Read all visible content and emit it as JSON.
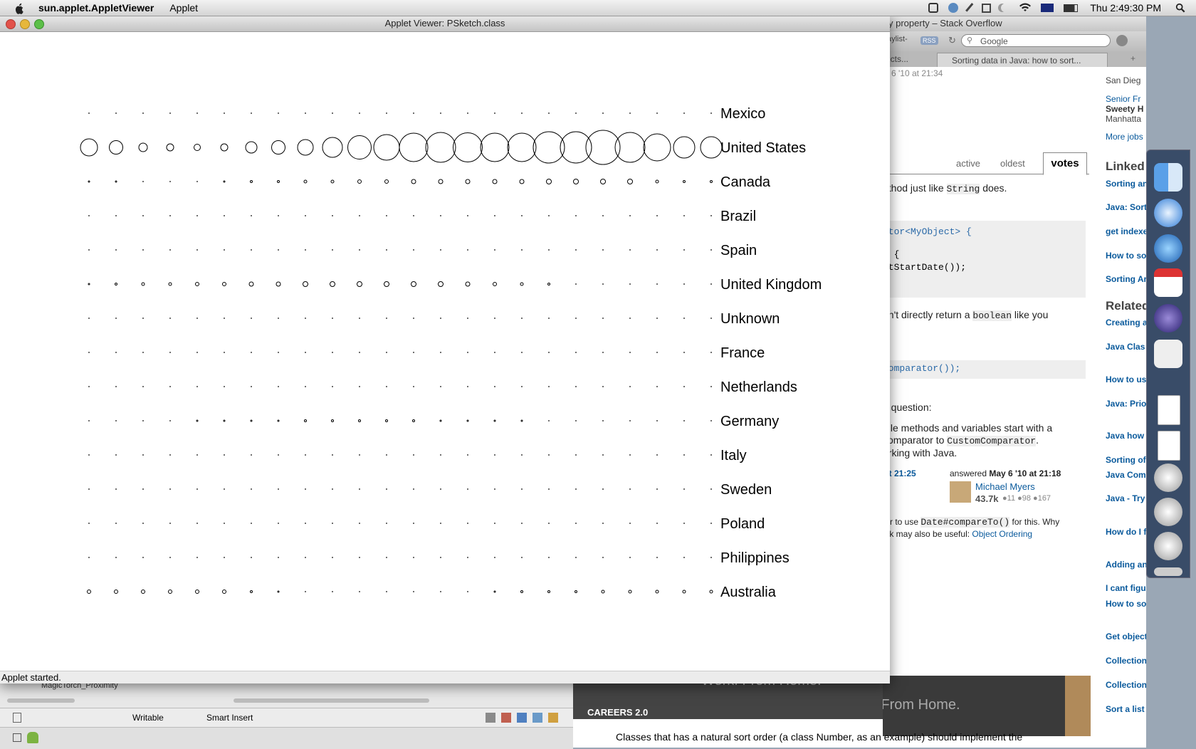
{
  "menubar": {
    "app_name": "sun.applet.AppletViewer",
    "menu_applet": "Applet",
    "clock": "Thu 2:49:30 PM"
  },
  "applet": {
    "title": "Applet Viewer: PSketch.class",
    "status": "Applet started.",
    "countries": [
      "Mexico",
      "United States",
      "Canada",
      "Brazil",
      "Spain",
      "United Kingdom",
      "Unknown",
      "France",
      "Netherlands",
      "Germany",
      "Italy",
      "Sweden",
      "Poland",
      "Philippines",
      "Australia"
    ],
    "columns": 24,
    "circle_diameters": [
      [
        1,
        1,
        1,
        1,
        1,
        1,
        1,
        1,
        1,
        1,
        1,
        1,
        1,
        1,
        1,
        1,
        1,
        1,
        1,
        1,
        1,
        1,
        1,
        1
      ],
      [
        24,
        19,
        12,
        10,
        9,
        10,
        16,
        19,
        22,
        28,
        33,
        36,
        40,
        42,
        41,
        40,
        40,
        44,
        44,
        48,
        42,
        38,
        30,
        30
      ],
      [
        2,
        2,
        1,
        1,
        1,
        2,
        3,
        3,
        4,
        4,
        5,
        5,
        6,
        6,
        6,
        6,
        6,
        7,
        7,
        7,
        7,
        4,
        3,
        3
      ],
      [
        1,
        1,
        1,
        1,
        1,
        1,
        1,
        1,
        1,
        1,
        1,
        1,
        1,
        1,
        1,
        1,
        1,
        1,
        1,
        1,
        1,
        1,
        1,
        1
      ],
      [
        1,
        1,
        1,
        1,
        1,
        1,
        1,
        1,
        1,
        1,
        1,
        1,
        1,
        1,
        1,
        1,
        1,
        1,
        1,
        1,
        1,
        1,
        1,
        1
      ],
      [
        2,
        3,
        4,
        4,
        5,
        5,
        6,
        6,
        7,
        7,
        7,
        7,
        7,
        7,
        6,
        5,
        4,
        3,
        1,
        1,
        1,
        1,
        1,
        1
      ],
      [
        1,
        1,
        1,
        1,
        1,
        1,
        1,
        1,
        1,
        1,
        1,
        1,
        1,
        1,
        1,
        1,
        1,
        1,
        1,
        1,
        1,
        1,
        1,
        1
      ],
      [
        1,
        1,
        1,
        1,
        1,
        1,
        1,
        1,
        1,
        1,
        1,
        1,
        1,
        1,
        1,
        1,
        1,
        1,
        1,
        1,
        1,
        1,
        1,
        1
      ],
      [
        1,
        1,
        1,
        1,
        1,
        1,
        1,
        1,
        1,
        1,
        1,
        1,
        1,
        1,
        1,
        1,
        1,
        1,
        1,
        1,
        1,
        1,
        1,
        1
      ],
      [
        1,
        1,
        1,
        1,
        2,
        2,
        2,
        2,
        3,
        3,
        3,
        3,
        3,
        2,
        2,
        2,
        2,
        1,
        1,
        1,
        1,
        1,
        1,
        1
      ],
      [
        1,
        1,
        1,
        1,
        1,
        1,
        1,
        1,
        1,
        1,
        1,
        1,
        1,
        1,
        1,
        1,
        1,
        1,
        1,
        1,
        1,
        1,
        1,
        1
      ],
      [
        1,
        1,
        1,
        1,
        1,
        1,
        1,
        1,
        1,
        1,
        1,
        1,
        1,
        1,
        1,
        1,
        1,
        1,
        1,
        1,
        1,
        1,
        1,
        1
      ],
      [
        1,
        1,
        1,
        1,
        1,
        1,
        1,
        1,
        1,
        1,
        1,
        1,
        1,
        1,
        1,
        1,
        1,
        1,
        1,
        1,
        1,
        1,
        1,
        1
      ],
      [
        1,
        1,
        1,
        1,
        1,
        1,
        1,
        1,
        1,
        1,
        1,
        1,
        1,
        1,
        1,
        1,
        1,
        1,
        1,
        1,
        1,
        1,
        1,
        1
      ],
      [
        5,
        5,
        5,
        5,
        5,
        5,
        3,
        2,
        1,
        1,
        1,
        1,
        1,
        1,
        1,
        2,
        3,
        3,
        3,
        4,
        4,
        4,
        4,
        4
      ]
    ]
  },
  "browser": {
    "title": "y property – Stack Overflow",
    "bookmark": "aylist-",
    "rss": "RSS",
    "search_placeholder": "Google",
    "tab_a": "ects...",
    "tab_b": "Sorting data in Java: how to sort...",
    "date_fragment": "6 '10 at 21:34",
    "tab_active": "active",
    "tab_oldest": "oldest",
    "tab_votes": "votes",
    "line1_pre": "ethod just like",
    "line1_code": "String",
    "line1_post": "does.",
    "code1": "ator<MyObject> {",
    "code2": ") {",
    "code3": "etStartDate());",
    "line2_pre": "dn't directly return a",
    "line2_code": "boolean",
    "line2_post": "like you",
    "code4": "Comparator());",
    "line3": "e question:",
    "line4": "hile methods and variables start with a",
    "line5_pre": "comparator to",
    "line5_code": "CustomComparator",
    "line6": "orking with Java.",
    "edited": "at 21:25",
    "answered": "answered",
    "answered_date": "May 6 '10 at 21:18",
    "user": "Michael Myers",
    "rep": "43.7k",
    "badges": "●11 ●98 ●167",
    "comment1_pre": "ter to use",
    "comment1_code": "Date#compareTo()",
    "comment1_post": "for this. Why",
    "comment2_pre": "ink may also be useful:",
    "comment2_link": "Object Ordering",
    "careers": "CAREERS 2.0",
    "work_home": "Work. From Home.",
    "bottom_text": "Classes that has a natural sort order (a class Number, as an example) should implement the",
    "side_job1": "Senior Fr",
    "side_job2": "Sweety H",
    "side_job3": "Manhatta",
    "side_job0": "San Dieg",
    "more_jobs": "More jobs",
    "linked": "Linked",
    "related": "Related",
    "linked_items": [
      "Sorting an based on",
      "Java: Sort an object",
      "get indexe in an array",
      "How to so name in ja",
      "Sorting Ar"
    ],
    "related_items": [
      "Creating a to sort a t",
      "Java Clas Generics, error",
      "How to us sort",
      "Java: Prio incorrect c comparato",
      "Java how Point obje",
      "Sorting of",
      "Java Com arrays",
      "Java - Try with a cus find symb",
      "How do I f to correct property?",
      "Adding an in the corr",
      "I cant figu",
      "How to so according compare a",
      "Get object based on",
      "Collection custom co",
      "Collection comparato",
      "Sort a list"
    ]
  },
  "eclipse": {
    "tree_item": "MagicTorch_Proximity",
    "writable": "Writable",
    "smart_insert": "Smart Insert"
  }
}
